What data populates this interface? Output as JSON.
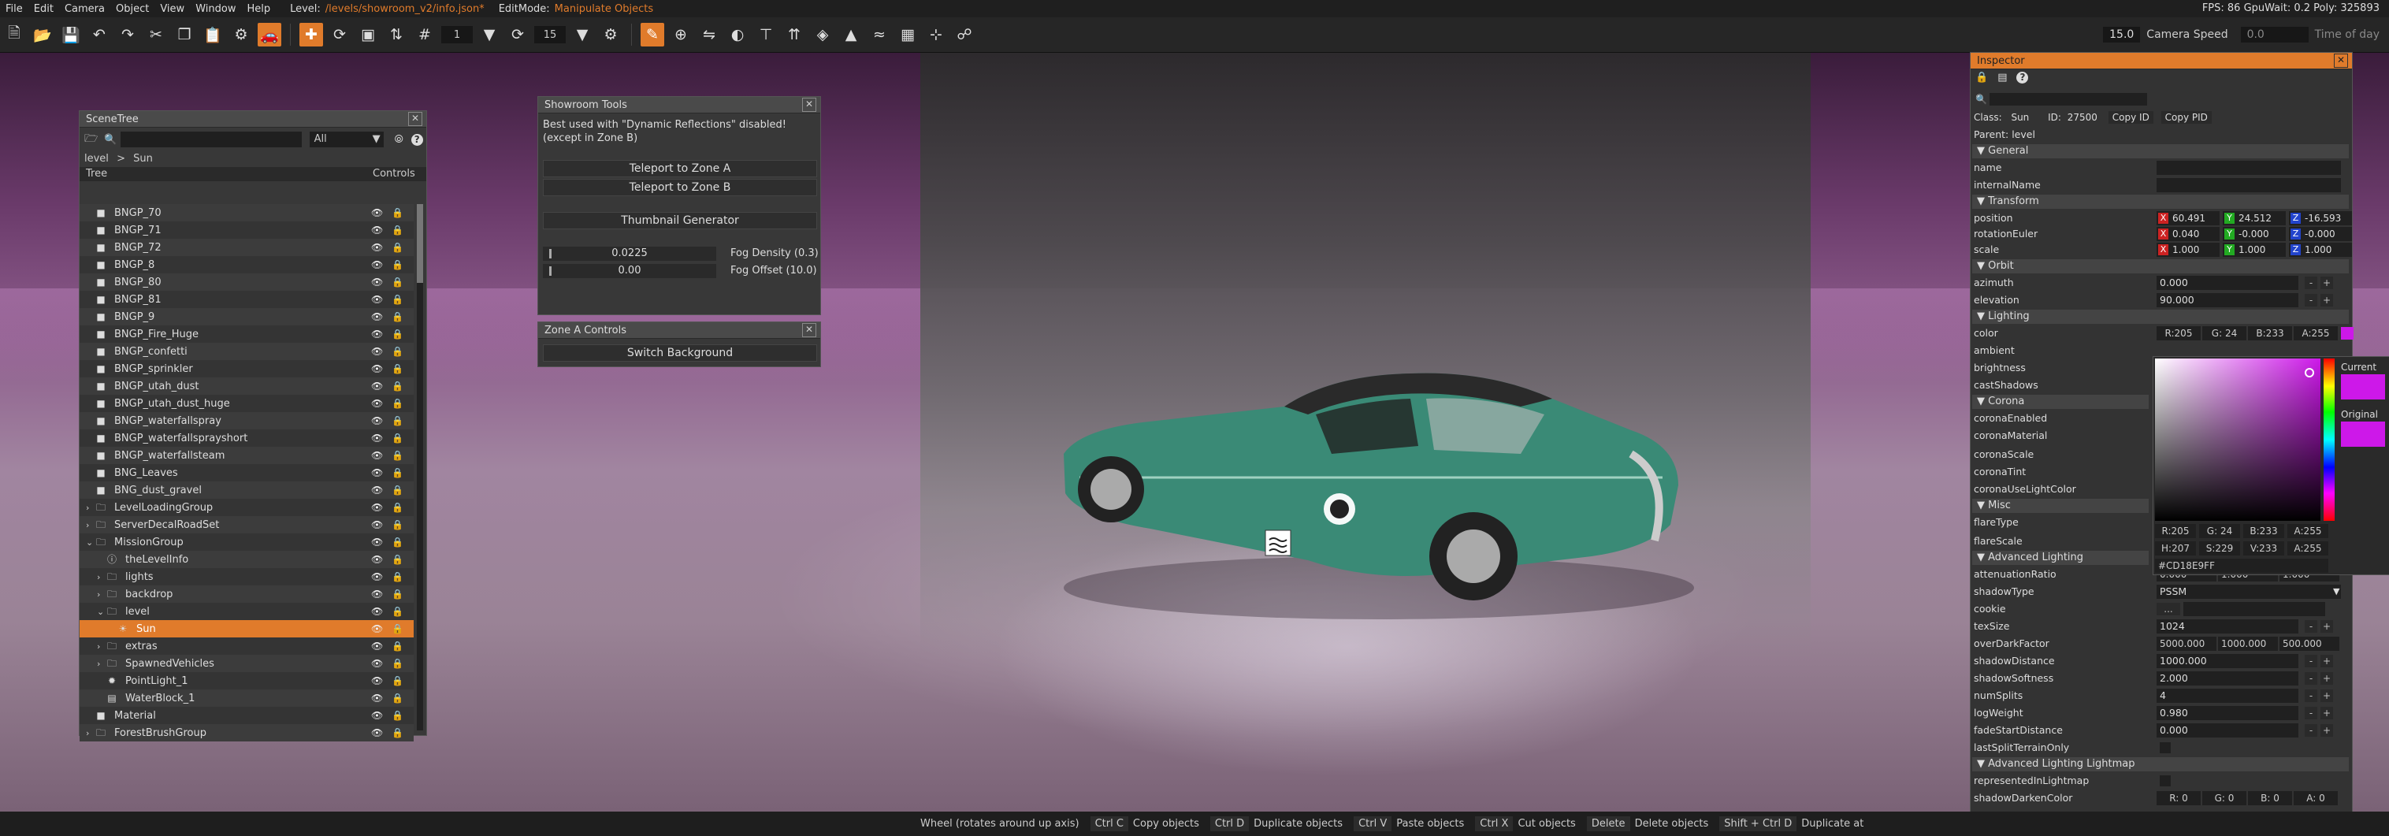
{
  "menu": {
    "items": [
      "File",
      "Edit",
      "Camera",
      "Object",
      "View",
      "Window",
      "Help"
    ],
    "level_label": "Level:",
    "level_value": "/levels/showroom_v2/info.json*",
    "editmode_label": "EditMode:",
    "editmode_value": "Manipulate Objects",
    "stats": "FPS: 86  GpuWait: 0.2  Poly: 325893"
  },
  "toolbar": {
    "snap_value": "1",
    "angle_value": "15",
    "speed_value": "15.0",
    "camera_speed_label": "Camera Speed",
    "time_value": "0.0",
    "time_label": "Time of day"
  },
  "scenetree": {
    "title": "SceneTree",
    "filter": "All",
    "breadcrumb_root": "level",
    "breadcrumb_sep": ">",
    "breadcrumb_leaf": "Sun",
    "col_tree": "Tree",
    "col_controls": "Controls",
    "rows": [
      {
        "label": "BNGP_70",
        "indent": 0
      },
      {
        "label": "BNGP_71",
        "indent": 0
      },
      {
        "label": "BNGP_72",
        "indent": 0
      },
      {
        "label": "BNGP_8",
        "indent": 0
      },
      {
        "label": "BNGP_80",
        "indent": 0
      },
      {
        "label": "BNGP_81",
        "indent": 0
      },
      {
        "label": "BNGP_9",
        "indent": 0
      },
      {
        "label": "BNGP_Fire_Huge",
        "indent": 0
      },
      {
        "label": "BNGP_confetti",
        "indent": 0
      },
      {
        "label": "BNGP_sprinkler",
        "indent": 0
      },
      {
        "label": "BNGP_utah_dust",
        "indent": 0
      },
      {
        "label": "BNGP_utah_dust_huge",
        "indent": 0
      },
      {
        "label": "BNGP_waterfallspray",
        "indent": 0
      },
      {
        "label": "BNGP_waterfallsprayshort",
        "indent": 0
      },
      {
        "label": "BNGP_waterfallsteam",
        "indent": 0
      },
      {
        "label": "BNG_Leaves",
        "indent": 0
      },
      {
        "label": "BNG_dust_gravel",
        "indent": 0
      },
      {
        "label": "LevelLoadingGroup",
        "indent": 0
      },
      {
        "label": "ServerDecalRoadSet",
        "indent": 0
      },
      {
        "label": "MissionGroup",
        "indent": 0
      },
      {
        "label": "theLevelInfo",
        "indent": 1
      },
      {
        "label": "lights",
        "indent": 1
      },
      {
        "label": "backdrop",
        "indent": 1
      },
      {
        "label": "level",
        "indent": 1
      },
      {
        "label": "Sun",
        "indent": 2
      },
      {
        "label": "extras",
        "indent": 1
      },
      {
        "label": "SpawnedVehicles",
        "indent": 1
      },
      {
        "label": "PointLight_1",
        "indent": 1
      },
      {
        "label": "WaterBlock_1",
        "indent": 1
      },
      {
        "label": "Material",
        "indent": 0
      },
      {
        "label": "ForestBrushGroup",
        "indent": 0
      }
    ]
  },
  "showroom": {
    "title": "Showroom Tools",
    "note_line1": "Best used with \"Dynamic Reflections\" disabled!",
    "note_line2": "(except in Zone B)",
    "teleport_a": "Teleport to Zone A",
    "teleport_b": "Teleport to Zone B",
    "thumbnail": "Thumbnail Generator",
    "fog_density_value": "0.0225",
    "fog_density_label": "Fog Density (0.3)",
    "fog_offset_value": "0.00",
    "fog_offset_label": "Fog Offset (10.0)"
  },
  "zonea": {
    "title": "Zone A Controls",
    "switch_bg": "Switch Background"
  },
  "inspector": {
    "title": "Inspector",
    "class_label": "Class:",
    "class_value": "Sun",
    "id_label": "ID:",
    "id_value": "27500",
    "copy_id": "Copy ID",
    "copy_pid": "Copy PID",
    "parent": "Parent: level",
    "sections": {
      "general": "General",
      "transform": "Transform",
      "orbit": "Orbit",
      "lighting": "Lighting",
      "corona": "Corona",
      "misc": "Misc",
      "adv_lighting": "Advanced Lighting",
      "adv_lightmap": "Advanced Lighting Lightmap"
    },
    "name": "name",
    "internal_name": "internalName",
    "position": "position",
    "pos_x": "60.491",
    "pos_y": "24.512",
    "pos_z": "-16.593",
    "rotation": "rotationEuler",
    "rot_x": "0.040",
    "rot_y": "-0.000",
    "rot_z": "-0.000",
    "scale": "scale",
    "sc_x": "1.000",
    "sc_y": "1.000",
    "sc_z": "1.000",
    "azimuth": "azimuth",
    "azimuth_value": "0.000",
    "elevation": "elevation",
    "elevation_value": "90.000",
    "color": "color",
    "color_r": "R:205",
    "color_g": "G: 24",
    "color_b": "B:233",
    "color_a": "A:255",
    "ambient": "ambient",
    "brightness": "brightness",
    "cast_shadows": "castShadows",
    "corona_enabled": "coronaEnabled",
    "corona_material": "coronaMaterial",
    "corona_scale": "coronaScale",
    "corona_tint": "coronaTint",
    "corona_use_light_color": "coronaUseLightColor",
    "flare_type": "flareType",
    "flare_scale": "flareScale",
    "picker_r": "R:205",
    "picker_g": "G: 24",
    "picker_b": "B:233",
    "picker_a": "A:255",
    "picker_h": "H:207",
    "picker_s": "S:229",
    "picker_v": "V:233",
    "picker_a2": "A:255",
    "picker_hex": "#CD18E9FF",
    "picker_current": "Current",
    "picker_original": "Original",
    "attenuation": "attenuationRatio",
    "att_1": "0.000",
    "att_2": "1.000",
    "att_3": "1.000",
    "shadow_type": "shadowType",
    "shadow_type_value": "PSSM",
    "cookie": "cookie",
    "cookie_btn": "...",
    "tex_size": "texSize",
    "tex_size_value": "1024",
    "over_dark": "overDarkFactor",
    "od_1": "5000.000",
    "od_2": "1000.000",
    "od_3": "500.000",
    "shadow_distance": "shadowDistance",
    "shadow_distance_value": "1000.000",
    "shadow_softness": "shadowSoftness",
    "shadow_softness_value": "2.000",
    "num_splits": "numSplits",
    "num_splits_value": "4",
    "log_weight": "logWeight",
    "log_weight_value": "0.980",
    "fade_start": "fadeStartDistance",
    "fade_start_value": "0.000",
    "last_split": "lastSplitTerrainOnly",
    "represented": "representedInLightmap",
    "shadow_darken": "shadowDarkenColor",
    "sd_r": "R: 0",
    "sd_g": "G: 0",
    "sd_b": "B: 0",
    "sd_a": "A: 0"
  },
  "status": {
    "hint": "Wheel (rotates around up axis)",
    "k1": "Ctrl C",
    "d1": "Copy objects",
    "k2": "Ctrl D",
    "d2": "Duplicate objects",
    "k3": "Ctrl V",
    "d3": "Paste objects",
    "k4": "Ctrl X",
    "d4": "Cut objects",
    "k5": "Delete",
    "d5": "Delete objects",
    "k6": "Shift + Ctrl D",
    "d6": "Duplicate at"
  },
  "colors": {
    "accent": "#e07b2b",
    "sun_color": "#cd18e9"
  }
}
